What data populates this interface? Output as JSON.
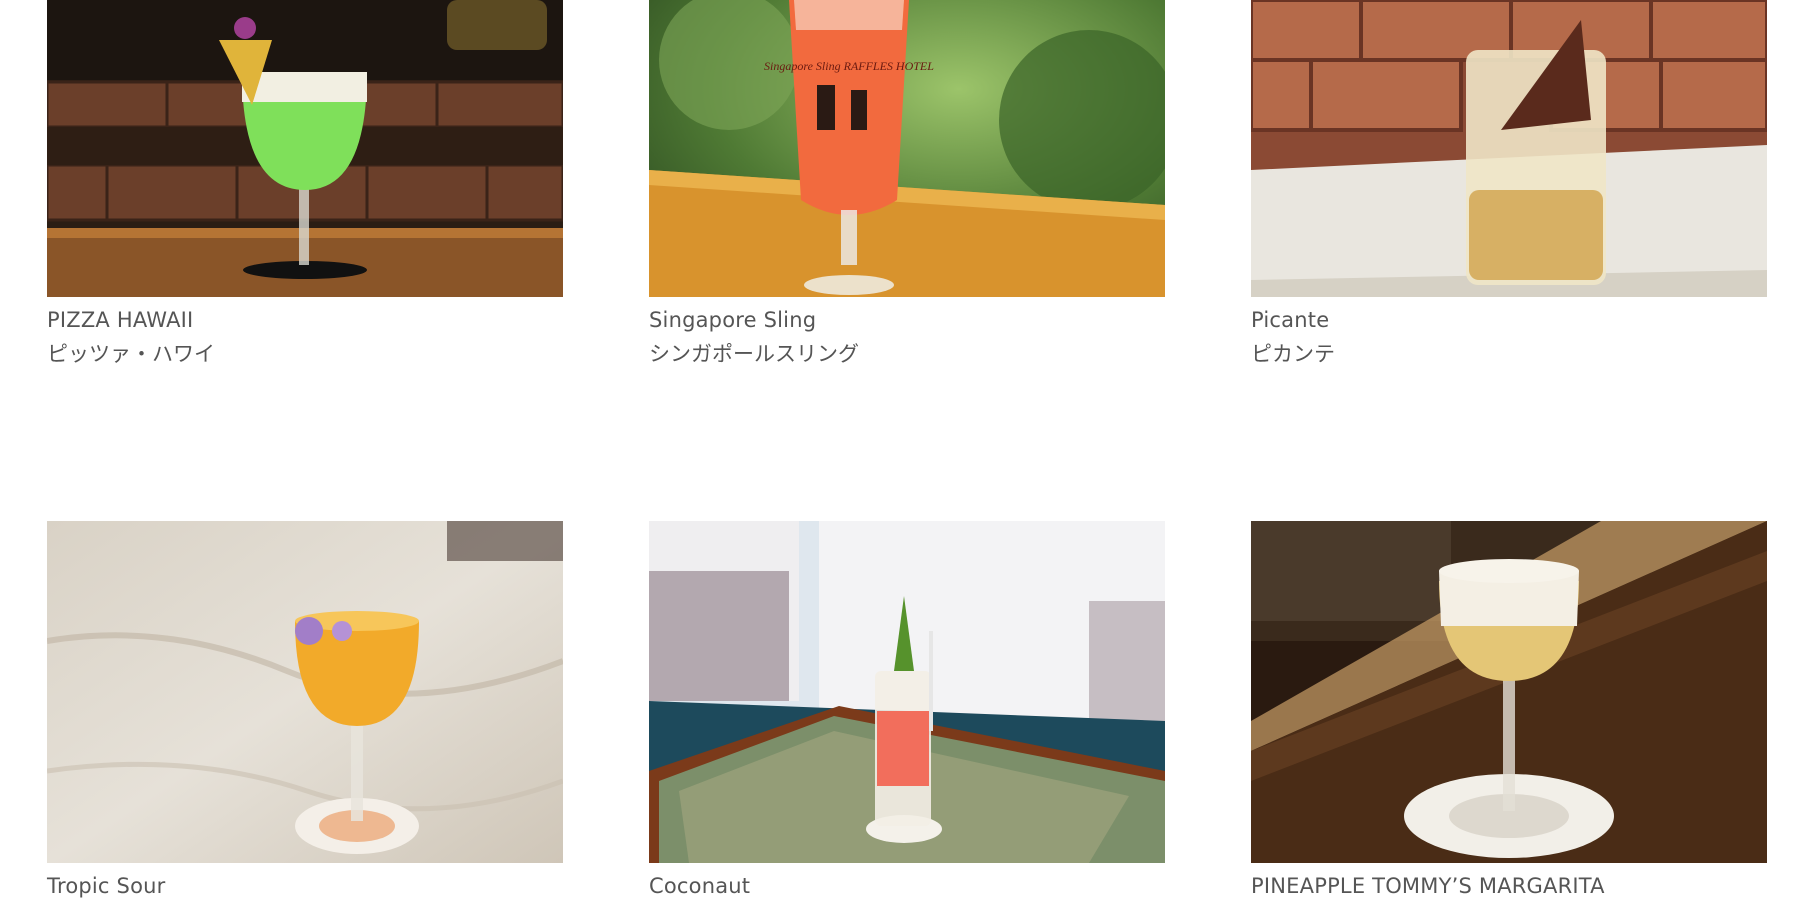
{
  "cocktails": [
    {
      "name_en": "PIZZA HAWAII",
      "name_ja": "ピッツァ・ハワイ",
      "photo_icon": "green-cocktail-photo"
    },
    {
      "name_en": "Singapore Sling",
      "name_ja": "シンガポールスリング",
      "photo_icon": "singapore-sling-photo",
      "glass_text": "Singapore Sling RAFFLES HOTEL"
    },
    {
      "name_en": "Picante",
      "name_ja": "ピカンテ",
      "photo_icon": "highball-photo"
    },
    {
      "name_en": "Tropic Sour",
      "photo_icon": "coupe-cocktail-photo"
    },
    {
      "name_en": "Coconaut",
      "photo_icon": "pink-tall-cocktail-photo"
    },
    {
      "name_en": "PINEAPPLE TOMMY’S MARGARITA",
      "photo_icon": "margarita-photo"
    }
  ]
}
